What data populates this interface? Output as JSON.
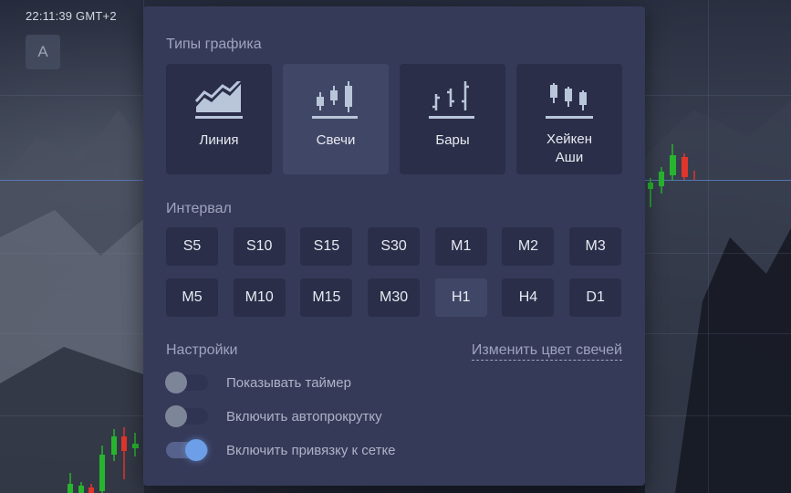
{
  "header": {
    "clock": "22:11:39 GMT+2",
    "account_letter": "A"
  },
  "chart_types": {
    "title": "Типы графика",
    "items": [
      {
        "key": "line",
        "label": "Линия",
        "icon": "line-chart-icon",
        "active": false
      },
      {
        "key": "candles",
        "label": "Свечи",
        "icon": "candlestick-icon",
        "active": true
      },
      {
        "key": "bars",
        "label": "Бары",
        "icon": "bar-chart-icon",
        "active": false
      },
      {
        "key": "heikin",
        "label": "Хейкен Аши",
        "icon": "heikin-ashi-icon",
        "active": false
      }
    ]
  },
  "interval": {
    "title": "Интервал",
    "options": [
      "S5",
      "S10",
      "S15",
      "S30",
      "M1",
      "M2",
      "M3",
      "M5",
      "M10",
      "M15",
      "M30",
      "H1",
      "H4",
      "D1"
    ],
    "selected": "H1"
  },
  "settings": {
    "title": "Настройки",
    "change_color_link": "Изменить цвет свечей",
    "toggles": [
      {
        "label": "Показывать таймер",
        "on": false
      },
      {
        "label": "Включить автопрокрутку",
        "on": false
      },
      {
        "label": "Включить привязку к сетке",
        "on": true
      }
    ]
  },
  "colors": {
    "panel": "#363a59",
    "card": "#2a2e48",
    "card_active": "#404766",
    "accent_blue": "#6d9fe8",
    "candle_up": "#27b42e",
    "candle_down": "#e0352b"
  }
}
